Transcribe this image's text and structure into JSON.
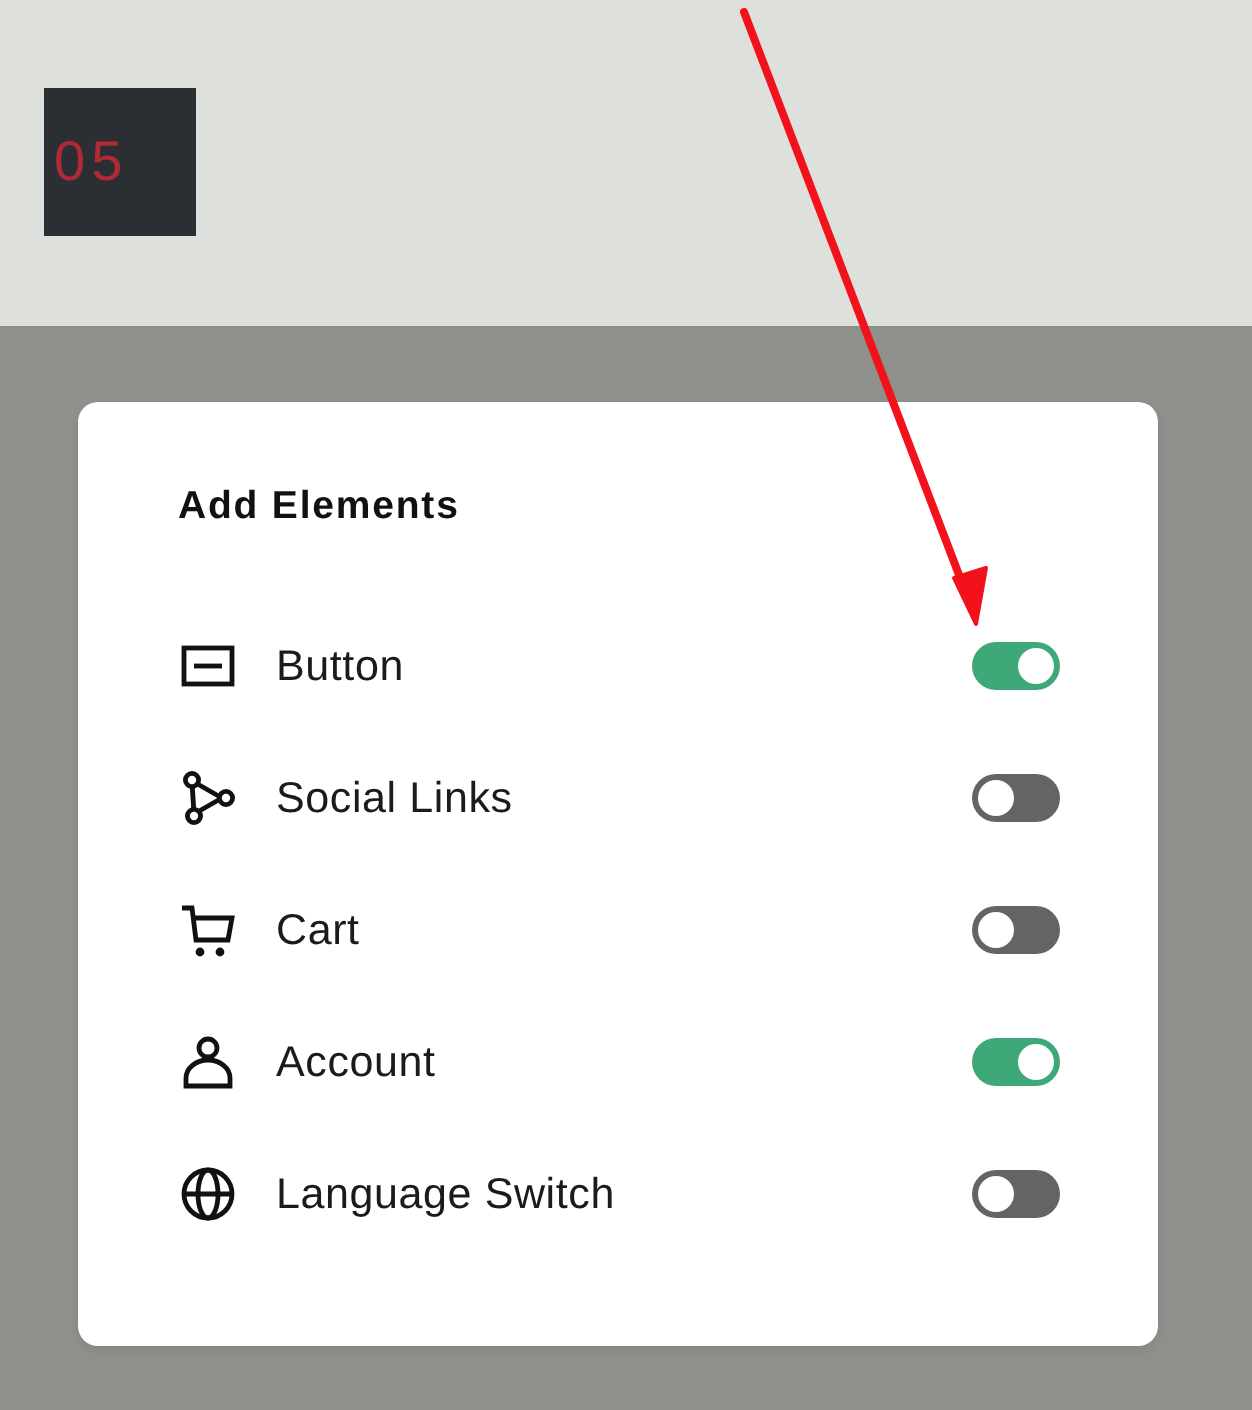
{
  "logo": {
    "text": "05"
  },
  "dialog": {
    "title": "Add Elements",
    "items": [
      {
        "kind": "button",
        "label": "Button",
        "on": true
      },
      {
        "kind": "social",
        "label": "Social Links",
        "on": false
      },
      {
        "kind": "cart",
        "label": "Cart",
        "on": false
      },
      {
        "kind": "account",
        "label": "Account",
        "on": true
      },
      {
        "kind": "language",
        "label": "Language Switch",
        "on": false
      }
    ]
  }
}
